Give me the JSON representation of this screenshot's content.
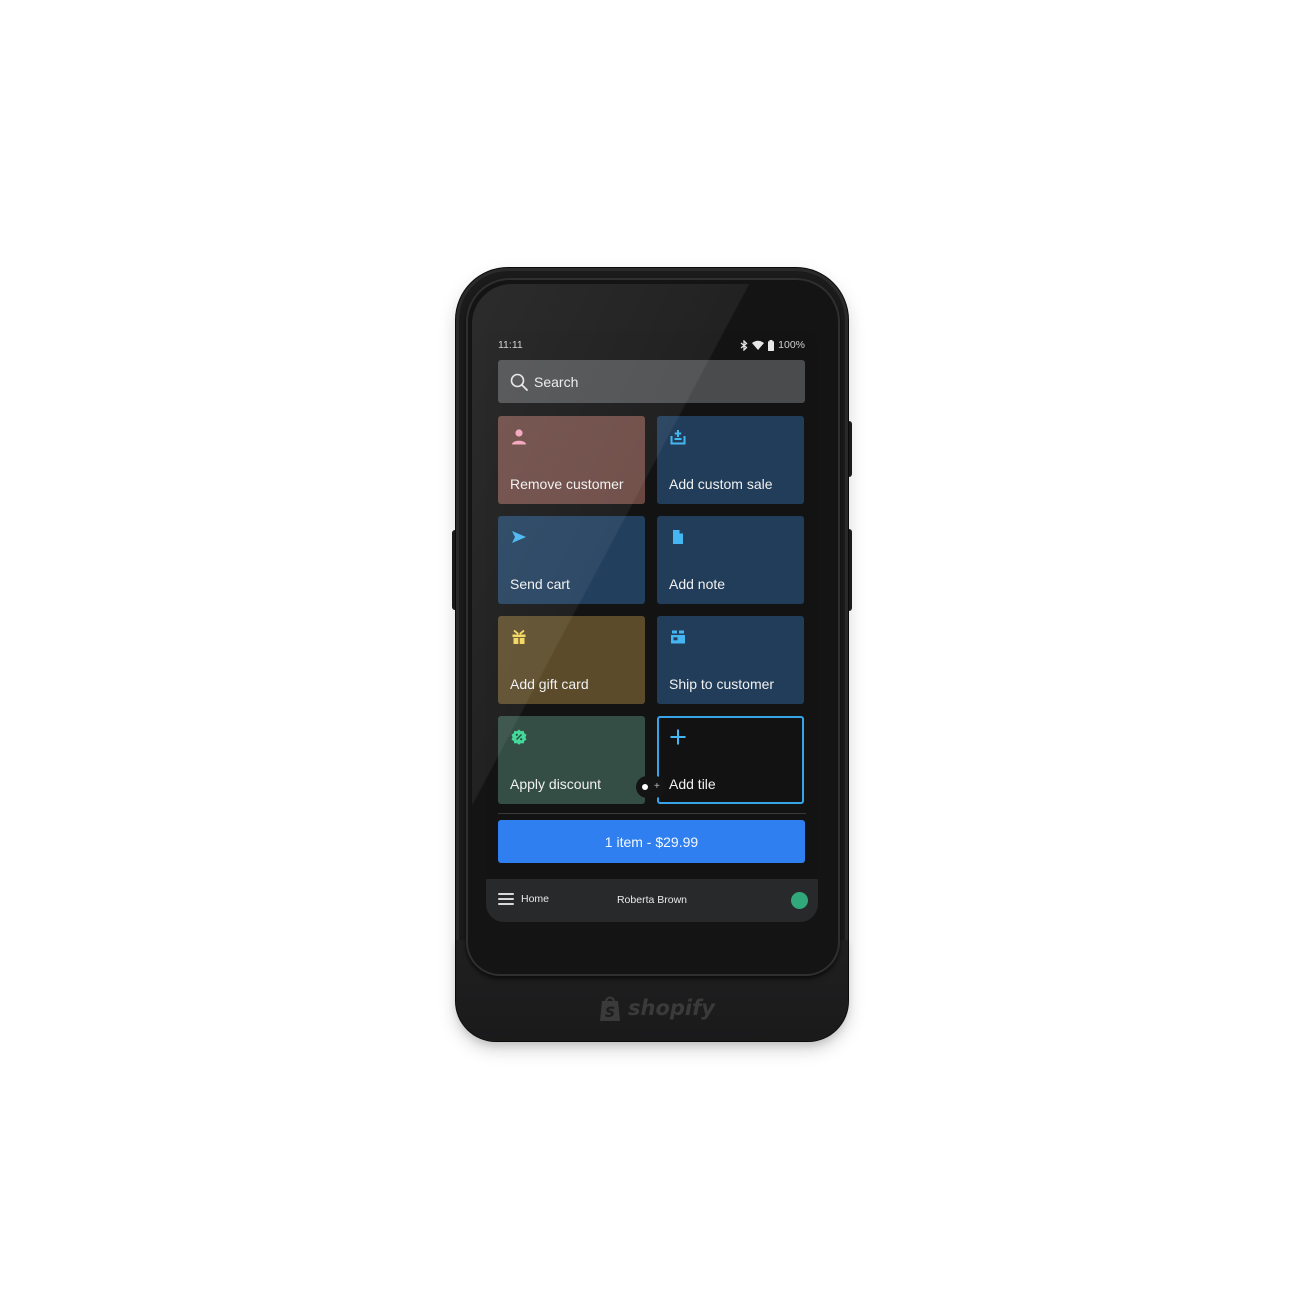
{
  "device": {
    "brand": "shopify"
  },
  "status_bar": {
    "time": "11:11",
    "icons": [
      "bluetooth-icon",
      "wifi-icon",
      "battery-icon"
    ],
    "battery": "100%"
  },
  "search": {
    "placeholder": "Search",
    "icon": "search-icon"
  },
  "tiles": [
    {
      "label": "Remove customer",
      "icon": "person-icon",
      "bg": "#6a4741",
      "icon_color": "#f4a3bb"
    },
    {
      "label": "Add custom sale",
      "icon": "tray-add-icon",
      "bg": "#213d5a",
      "icon_color": "#45b6f2"
    },
    {
      "label": "Send cart",
      "icon": "send-icon",
      "bg": "#223f5d",
      "icon_color": "#45b6f2"
    },
    {
      "label": "Add note",
      "icon": "note-icon",
      "bg": "#213d5a",
      "icon_color": "#45b6f2"
    },
    {
      "label": "Add gift card",
      "icon": "gift-icon",
      "bg": "#5b4b2a",
      "icon_color": "#f3d65a"
    },
    {
      "label": "Ship to customer",
      "icon": "shipping-box-icon",
      "bg": "#213d5a",
      "icon_color": "#45b6f2"
    },
    {
      "label": "Apply discount",
      "icon": "discount-icon",
      "bg": "#344e45",
      "icon_color": "#44d99a"
    },
    {
      "label": "Add tile",
      "icon": "plus-icon",
      "bg": "#121213",
      "icon_color": "#45b6f2"
    }
  ],
  "pager": {
    "current_page": 1,
    "add_page": "+"
  },
  "checkout": {
    "label": "1 item - $29.99",
    "color": "#2f7ff0"
  },
  "bottom_bar": {
    "menu_label": "Home",
    "staff_name": "Roberta Brown",
    "status_color": "#31a77c"
  }
}
